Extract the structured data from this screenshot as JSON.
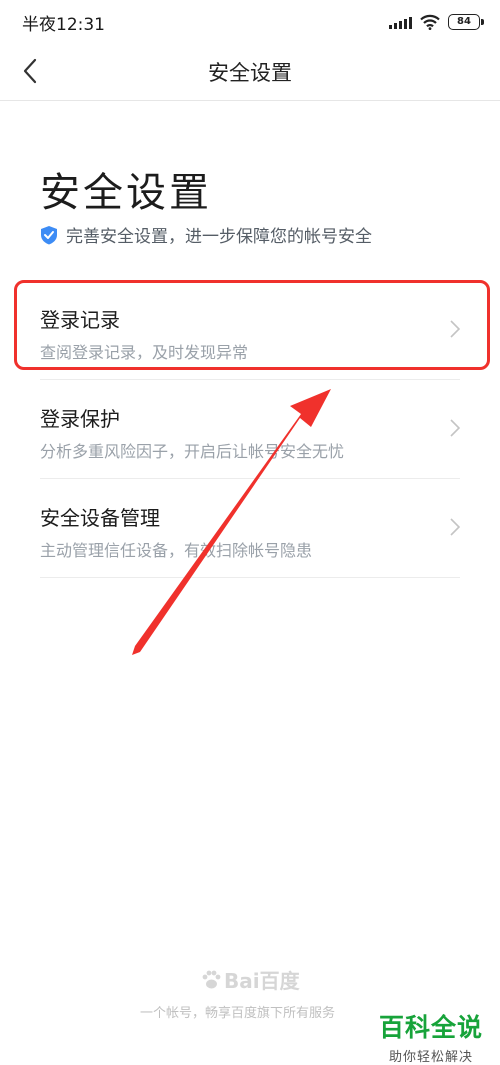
{
  "status_bar": {
    "time": "半夜12:31",
    "battery": "84"
  },
  "nav": {
    "title": "安全设置"
  },
  "page": {
    "title": "安全设置",
    "subtitle": "完善安全设置，进一步保障您的帐号安全"
  },
  "menu": {
    "items": [
      {
        "title": "登录记录",
        "desc": "查阅登录记录，及时发现异常"
      },
      {
        "title": "登录保护",
        "desc": "分析多重风险因子，开启后让帐号安全无忧"
      },
      {
        "title": "安全设备管理",
        "desc": "主动管理信任设备，有效扫除帐号隐患"
      }
    ]
  },
  "footer": {
    "logo_text": "Bai百度",
    "text": "一个帐号，畅享百度旗下所有服务"
  },
  "watermark": {
    "main": "百科全说",
    "sub": "助你轻松解决"
  },
  "colors": {
    "highlight": "#f0312c",
    "shield": "#3d8cf5",
    "watermark": "#17a33a"
  },
  "icons": {
    "back": "chevron-left-icon",
    "shield": "shield-check-icon",
    "chevron": "chevron-right-icon",
    "wifi": "wifi-icon",
    "signal": "signal-icon",
    "battery": "battery-icon"
  }
}
